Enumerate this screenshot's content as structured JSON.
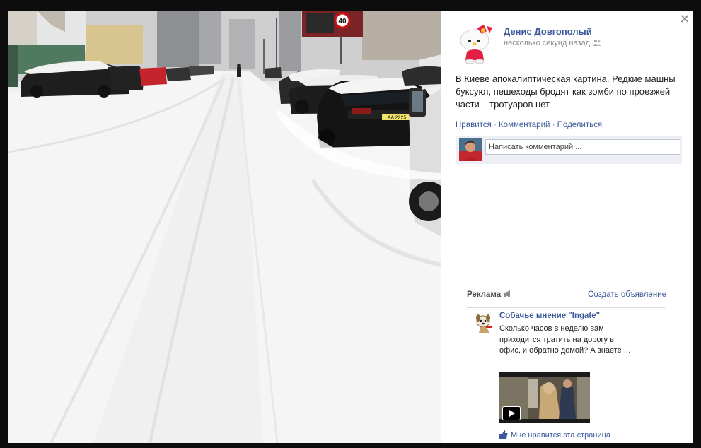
{
  "post": {
    "author_name": "Денис Довгополый",
    "timestamp": "несколько секунд назад",
    "audience_icon": "friends-icon",
    "text": "В Киеве апокалиптическая картина. Редкие машны буксуют, пешеходы бродят как зомби по проезжей части – тротуаров нет",
    "actions": {
      "like": "Нравится",
      "comment": "Комментарий",
      "share": "Поделиться",
      "separator": " · "
    },
    "comment_placeholder": "Написать комментарий ..."
  },
  "ads": {
    "title": "Реклама",
    "create_ad": "Создать объявление",
    "item": {
      "name": "Собачье мнение \"Ingate\"",
      "body": "Сколько часов в неделю вам приходится тратить на дорогу в офис, и обратно домой? А знаете",
      "more": "...",
      "like_page": "Мне нравится эта страница"
    }
  },
  "photo": {
    "speed_sign": "40",
    "plate": "AA 2225"
  },
  "colors": {
    "link": "#3b5998",
    "backdrop": "#0d0d0d",
    "comment_bg": "#edeff4"
  }
}
